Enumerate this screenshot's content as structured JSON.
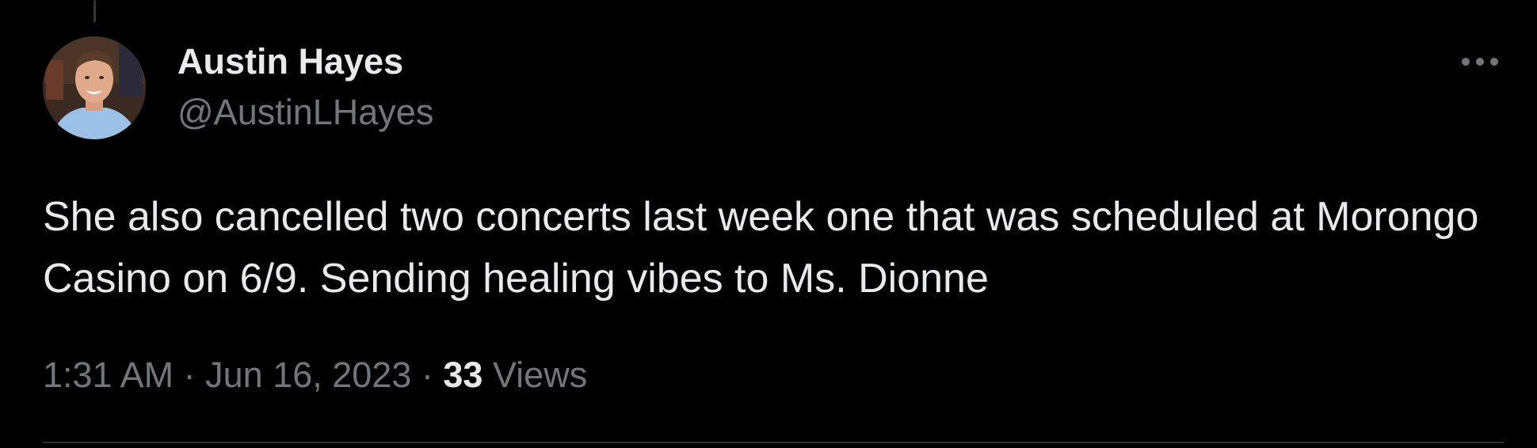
{
  "tweet": {
    "author": {
      "display_name": "Austin Hayes",
      "handle": "@AustinLHayes"
    },
    "text": "She also cancelled two concerts last week one that was scheduled at Morongo Casino on 6/9. Sending healing vibes to Ms. Dionne",
    "time": "1:31 AM",
    "separator": "·",
    "date": "Jun 16, 2023",
    "views_count": "33",
    "views_label": "Views",
    "more_icon": "more-horizontal-icon"
  },
  "colors": {
    "background": "#000000",
    "primary_text": "#e7e9ea",
    "secondary_text": "#71767b",
    "divider": "#2f3336"
  }
}
